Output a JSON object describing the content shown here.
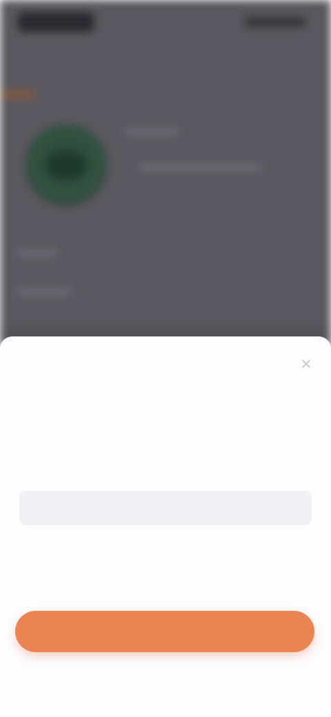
{
  "background_app": {
    "status_time": "",
    "brand_color": "#5b5760",
    "logo_icon": "app-logo-icon",
    "accent_color": "#8a5a3a"
  },
  "sheet": {
    "title": "",
    "close_icon": "close-icon",
    "field_value": "",
    "field_caption": "",
    "primary_button_label": "",
    "primary_color": "#ea8453"
  }
}
